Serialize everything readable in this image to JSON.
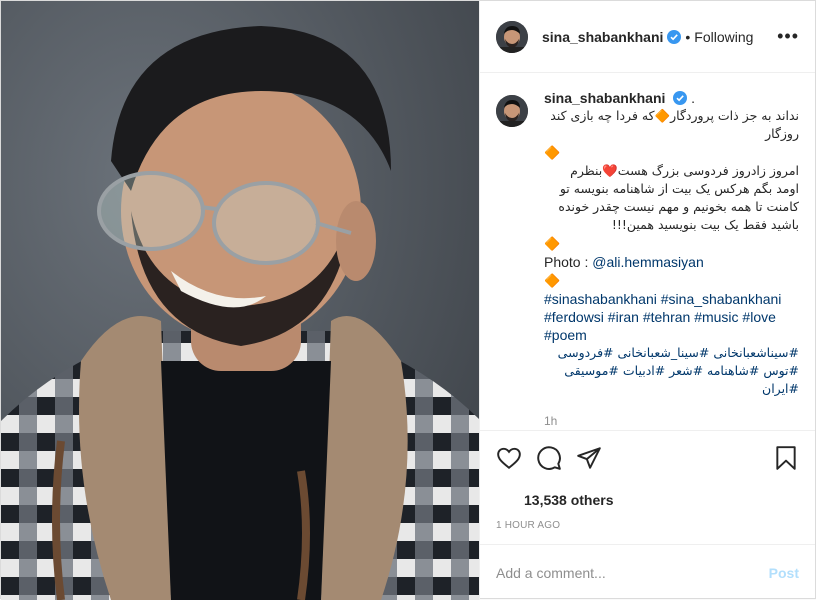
{
  "header": {
    "username": "sina_shabankhani",
    "follow_status": "Following",
    "separator": "•",
    "more": "•••"
  },
  "caption": {
    "username": "sina_shabankhani",
    "trailing": ".",
    "line1": "نداند به جز ذات پروردگار🔶که فردا چه بازی کند روزگار",
    "diamond": "🔶",
    "line2": "امروز زادروز فردوسی بزرگ هست❤️بنظرم اومد بگم هرکس یک بیت از شاهنامه بنویسه تو کامنت تا همه بخونیم و مهم نیست چقدر خونده باشید فقط یک بیت بنویسید همین!!!",
    "photo_prefix": "Photo : ",
    "photo_credit": "@ali.hemmasiyan",
    "hashtags_en": "#sinashabankhani #sina_shabankhani #ferdowsi #iran #tehran #music #love #poem",
    "hashtags_fa": "#سیناشعبانخانی #سینا_شعبانخانی #فردوسی #توس #شاهنامه #شعر #ادبیات #موسیقی #ایران",
    "time": "1h"
  },
  "stats": {
    "likes": "13,538 others",
    "posted": "1 HOUR AGO"
  },
  "comment": {
    "placeholder": "Add a comment...",
    "post_label": "Post"
  },
  "icons": {
    "like": "heart-icon",
    "comment": "comment-icon",
    "share": "share-icon",
    "save": "bookmark-icon",
    "verified": "verified-badge-icon"
  },
  "colors": {
    "link": "#00376b",
    "verified": "#3897f0",
    "post_disabled": "#b2dffc",
    "diamond": "#f27a54"
  }
}
